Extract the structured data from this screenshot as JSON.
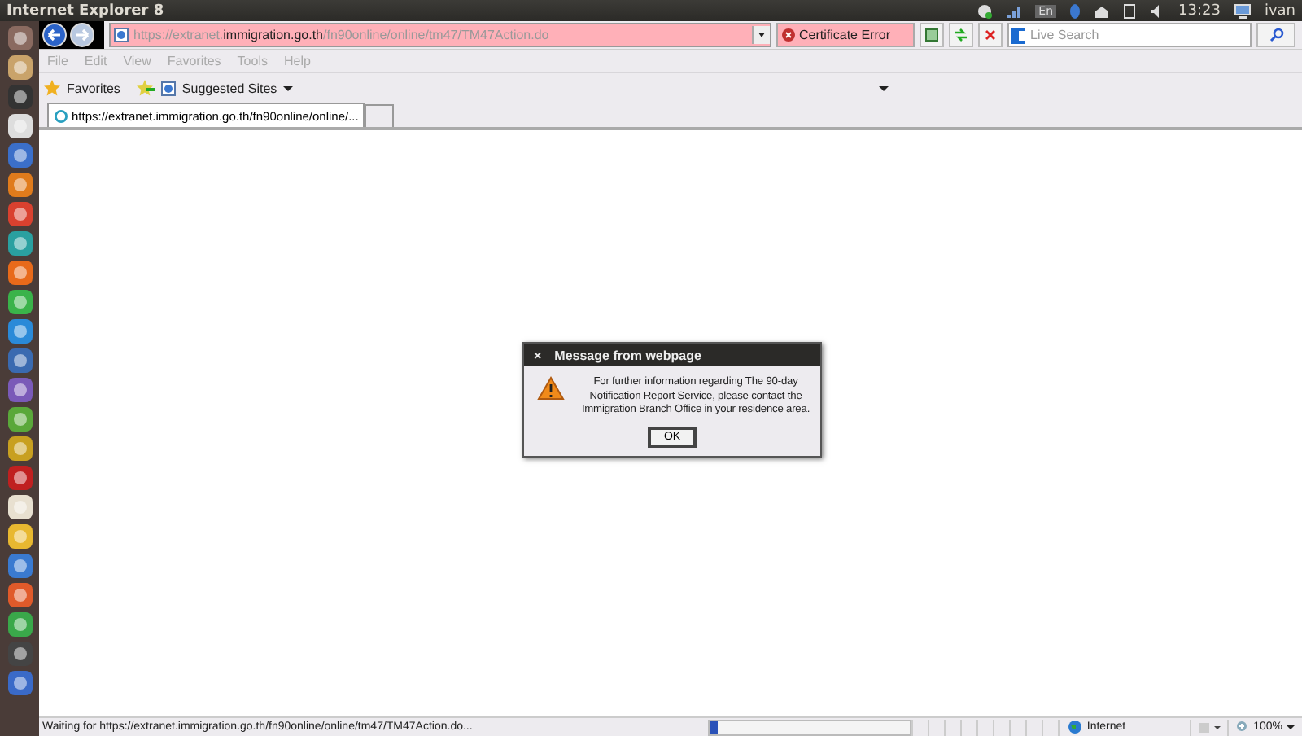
{
  "top_panel": {
    "title": "Internet Explorer 8",
    "keyboard": "En",
    "time": "13:23",
    "user": "ivan"
  },
  "address_bar": {
    "url": "https://extranet.**immigration.go.th**/fn90online/online/tm47/TM47Action.do",
    "certificate": "Certificate Error",
    "search": {
      "placeholder": "Live Search"
    }
  },
  "menu": [
    "File",
    "Edit",
    "View",
    "Favorites",
    "Tools",
    "Help"
  ],
  "favorites_bar": {
    "favorites": "Favorites",
    "suggested": "Suggested Sites"
  },
  "tabs": [
    {
      "label": "https://extranet.immigration.go.th/fn90online/online/...",
      "selected": true
    }
  ],
  "dialog": {
    "title": "Message from webpage",
    "close": "×",
    "message": "For further information regarding The 90-day Notification Report Service, please contact the Immigration Branch Office in your residence area.",
    "button": "OK"
  },
  "status_bar": {
    "text": "Waiting for https://extranet.immigration.go.th/fn90online/online/tm47/TM47Action.do...",
    "progress": {
      "level": 0.04
    },
    "zone": "Internet",
    "zoom": "100%"
  }
}
